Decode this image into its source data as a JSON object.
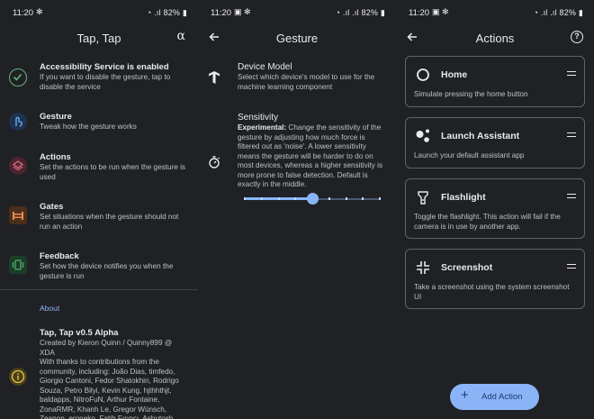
{
  "status": {
    "time": "11:20",
    "battery": "82%"
  },
  "main": {
    "title": "Tap, Tap",
    "items": [
      {
        "title": "Accessibility Service is enabled",
        "desc": "If you want to disable the gesture, tap to disable the service",
        "icon": "check-circle-icon",
        "color": "#5fb57a"
      },
      {
        "title": "Gesture",
        "desc": "Tweak how the gesture works",
        "icon": "gesture-tap-icon",
        "color": "#5b9ee8"
      },
      {
        "title": "Actions",
        "desc": "Set the actions to be run when the gesture is used",
        "icon": "layers-icon",
        "color": "#e06c7a"
      },
      {
        "title": "Gates",
        "desc": "Set situations when the gesture should not run an action",
        "icon": "gate-icon",
        "color": "#e88a4d"
      },
      {
        "title": "Feedback",
        "desc": "Set how the device notifies you when the gesture is run",
        "icon": "vibration-icon",
        "color": "#4fb06b"
      }
    ],
    "about_header": "About",
    "about": {
      "title": "Tap, Tap v0.5 Alpha",
      "desc": "Created by Kieron Quinn / Quinny899 @ XDA\nWith thanks to contributions from the community, including: João Dias, timfedo, Giorgio Cantoni, Fedor Shatokhin, Rodrigo Souza, Petro Bilyi, Kevin Kung, hjthhthjt, baldapps, NitroFuN, Arthur Fontaine, ZonaRMR, Khanh Le, Gregor Wünsch, Zeanon, eroneko, Fatih Fırıncı, Ashutosh"
    }
  },
  "gesture": {
    "title": "Gesture",
    "device_model": {
      "title": "Device Model",
      "desc": "Select which device's model to use for the machine learning component"
    },
    "sensitivity": {
      "title": "Sensitivity",
      "bold": "Experimental:",
      "desc": " Change the sensitivity of the gesture by adjusting how much force is filtered out as 'noise'. A lower sensitivity means the gesture will be harder to do on most devices, whereas a higher sensitivity is more prone to false detection. Default is exactly in the middle.",
      "value": 0.5
    }
  },
  "actions": {
    "title": "Actions",
    "cards": [
      {
        "title": "Home",
        "desc": "Simulate pressing the home button",
        "icon": "home-circle-icon"
      },
      {
        "title": "Launch Assistant",
        "desc": "Launch your default assistant app",
        "icon": "assistant-icon"
      },
      {
        "title": "Flashlight",
        "desc": "Toggle the flashlight. This action will fail if the camera is in use by another app.",
        "icon": "flashlight-icon"
      },
      {
        "title": "Screenshot",
        "desc": "Take a screenshot using the system screenshot UI",
        "icon": "screenshot-icon"
      }
    ],
    "fab_label": "Add Action"
  }
}
